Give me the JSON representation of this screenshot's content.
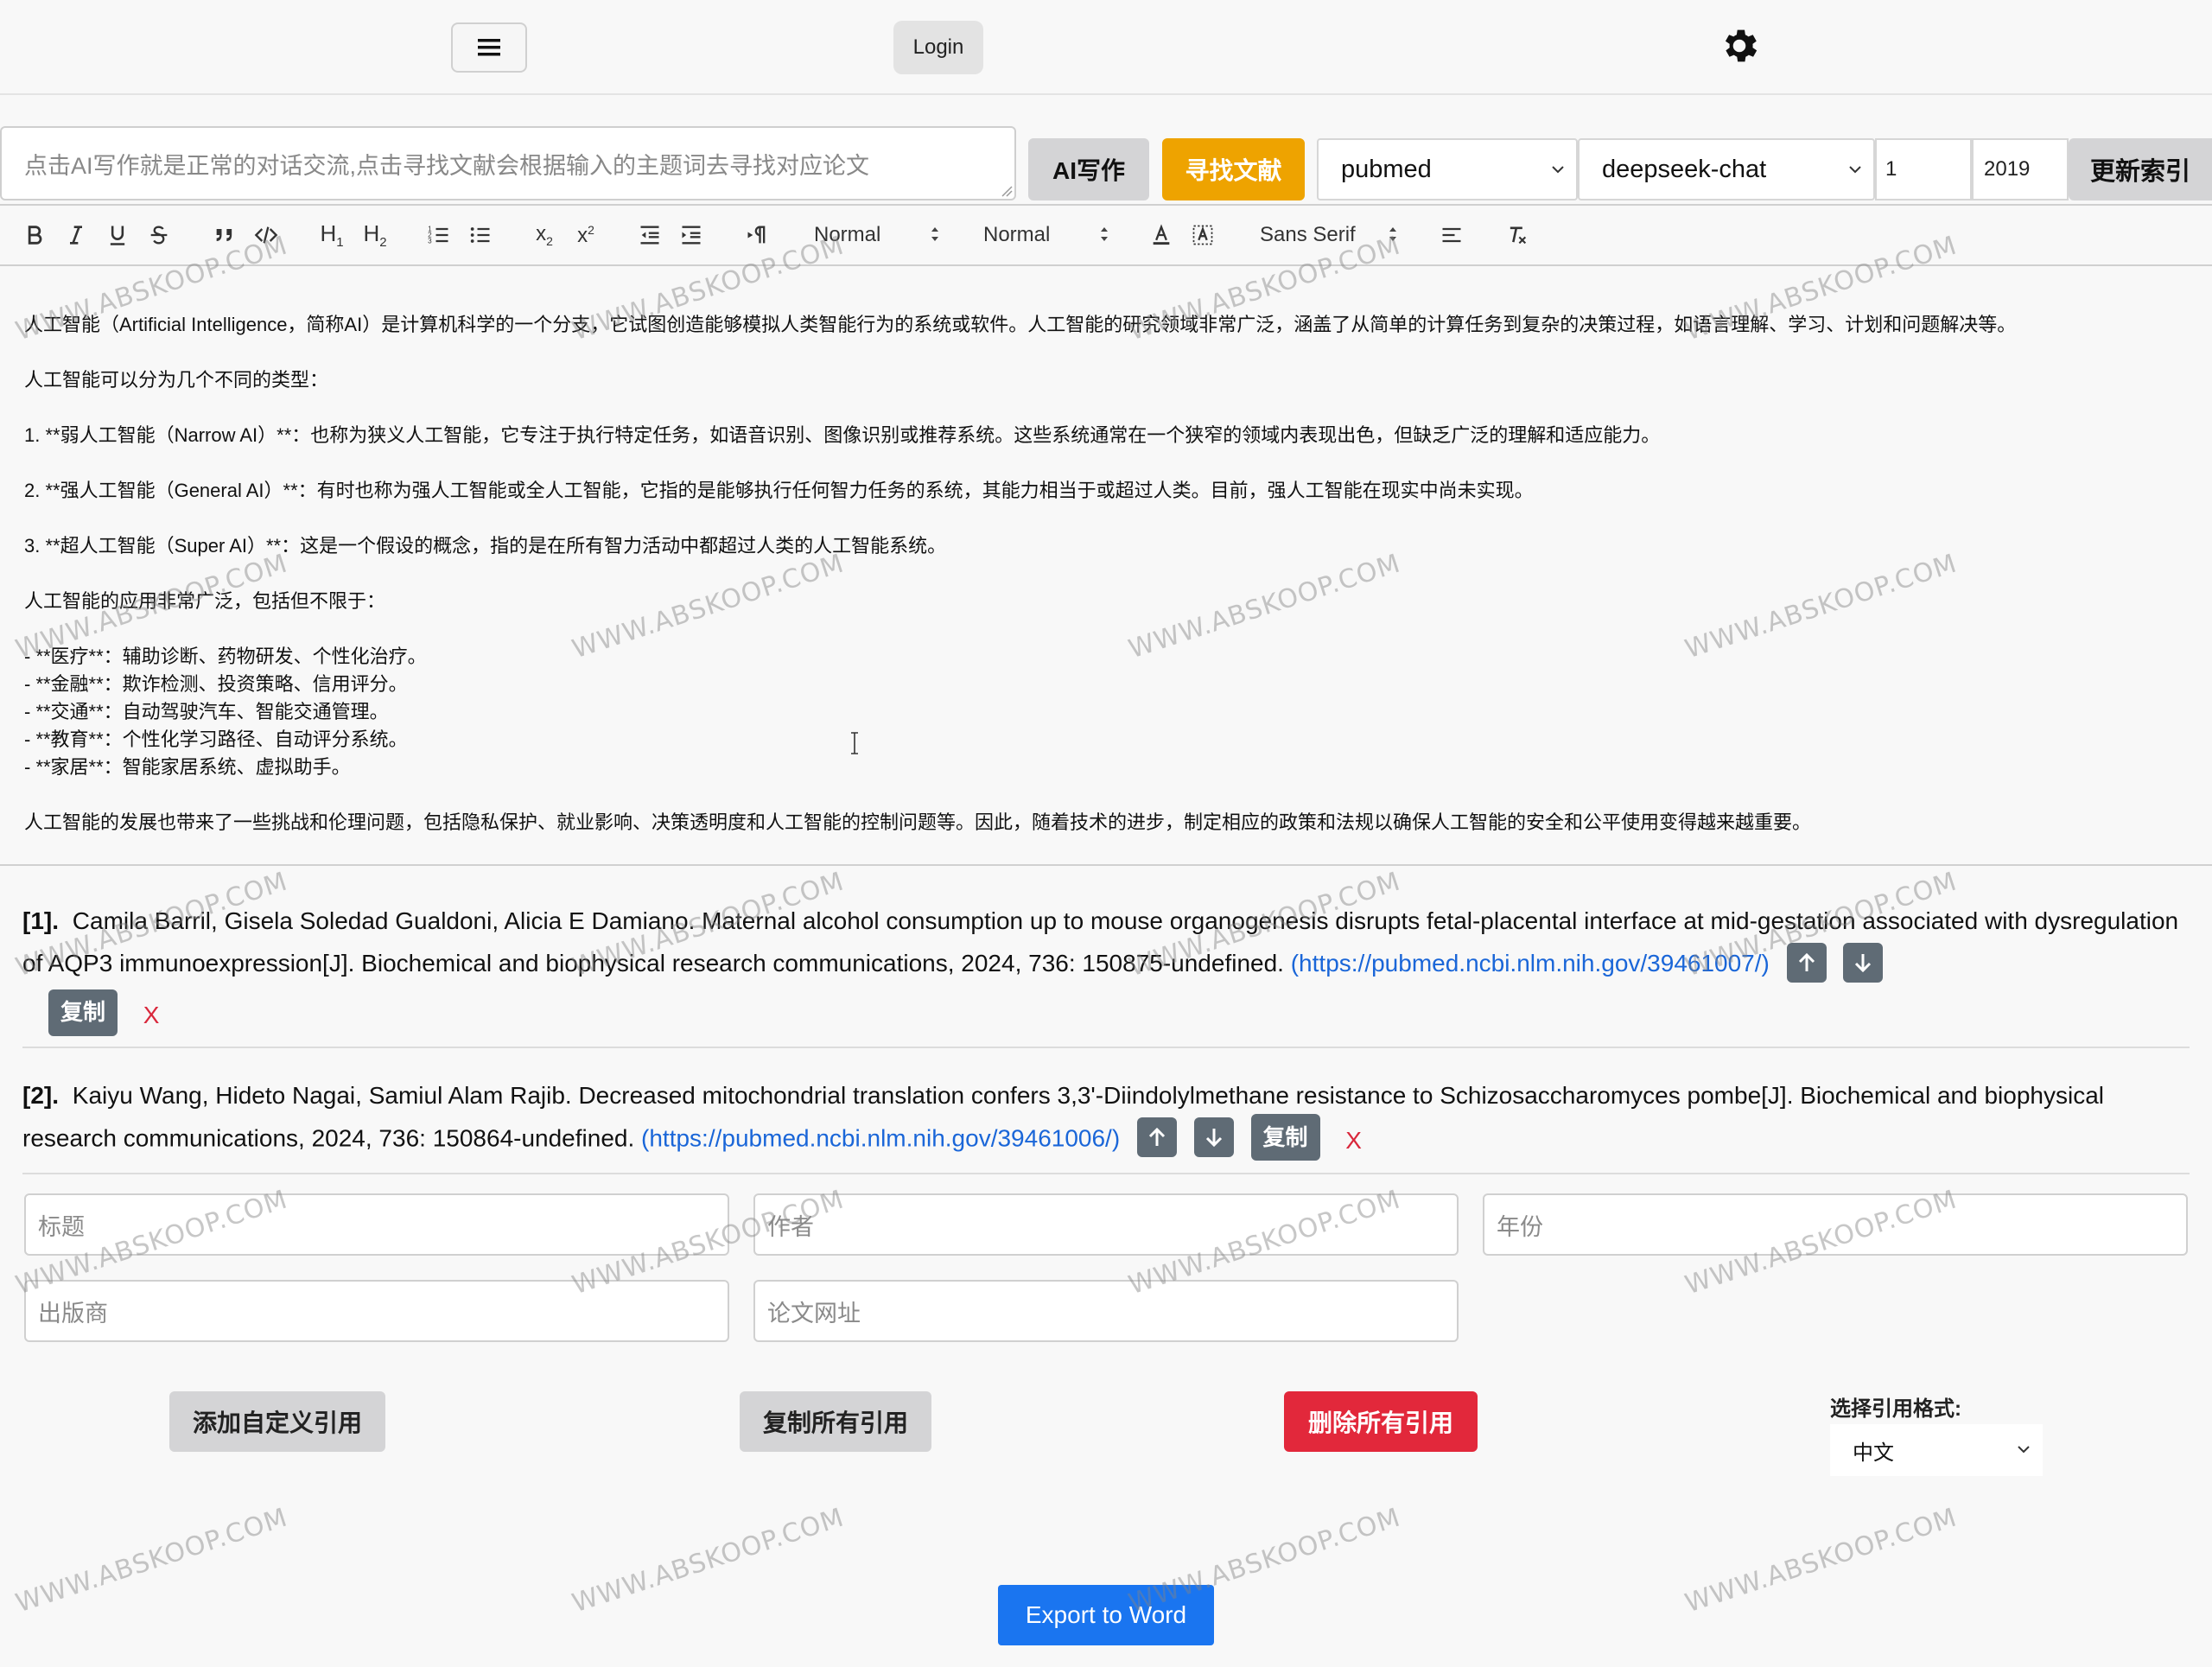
{
  "header": {
    "login_label": "Login"
  },
  "query": {
    "placeholder": "点击AI写作就是正常的对话交流,点击寻找文献会根据输入的主题词去寻找对应论文",
    "ai_write_label": "AI写作",
    "find_label": "寻找文献",
    "source_value": "pubmed",
    "model_value": "deepseek-chat",
    "count_value": "1",
    "year_value": "2019",
    "update_label": "更新索引"
  },
  "toolbar": {
    "header_pick": "Normal",
    "size_pick": "Normal",
    "font_pick": "Sans Serif"
  },
  "editor": {
    "lines": [
      "人工智能（Artificial Intelligence，简称AI）是计算机科学的一个分支，它试图创造能够模拟人类智能行为的系统或软件。人工智能的研究领域非常广泛，涵盖了从简单的计算任务到复杂的决策过程，如语言理解、学习、计划和问题解决等。",
      "人工智能可以分为几个不同的类型：",
      "1. **弱人工智能（Narrow AI）**：也称为狭义人工智能，它专注于执行特定任务，如语音识别、图像识别或推荐系统。这些系统通常在一个狭窄的领域内表现出色，但缺乏广泛的理解和适应能力。",
      "2. **强人工智能（General AI）**：有时也称为强人工智能或全人工智能，它指的是能够执行任何智力任务的系统，其能力相当于或超过人类。目前，强人工智能在现实中尚未实现。",
      "3. **超人工智能（Super AI）**：这是一个假设的概念，指的是在所有智力活动中都超过人类的人工智能系统。",
      "人工智能的应用非常广泛，包括但不限于：",
      "- **医疗**：辅助诊断、药物研发、个性化治疗。",
      "- **金融**：欺诈检测、投资策略、信用评分。",
      "- **交通**：自动驾驶汽车、智能交通管理。",
      "- **教育**：个性化学习路径、自动评分系统。",
      "- **家居**：智能家居系统、虚拟助手。",
      "人工智能的发展也带来了一些挑战和伦理问题，包括隐私保护、就业影响、决策透明度和人工智能的控制问题等。因此，随着技术的进步，制定相应的政策和法规以确保人工智能的安全和公平使用变得越来越重要。"
    ]
  },
  "references": [
    {
      "index": "[1].",
      "text": "Camila Barril, Gisela Soledad Gualdoni, Alicia E Damiano. Maternal alcohol consumption up to mouse organogenesis disrupts fetal-placental interface at mid-gestation associated with dysregulation of AQP3 immunoexpression[J]. Biochemical and biophysical research communications, 2024, 736: 150875-undefined.",
      "link": "(https://pubmed.ncbi.nlm.nih.gov/39461007/)",
      "copy_label": "复制",
      "delete_label": "X"
    },
    {
      "index": "[2].",
      "text": "Kaiyu Wang, Hideto Nagai, Samiul Alam Rajib. Decreased mitochondrial translation confers 3,3'-Diindolylmethane resistance to Schizosaccharomyces pombe[J]. Biochemical and biophysical research communications, 2024, 736: 150864-undefined.",
      "link": "(https://pubmed.ncbi.nlm.nih.gov/39461006/)",
      "copy_label": "复制",
      "delete_label": "X"
    }
  ],
  "custom_ref": {
    "title_placeholder": "标题",
    "author_placeholder": "作者",
    "year_placeholder": "年份",
    "publisher_placeholder": "出版商",
    "url_placeholder": "论文网址"
  },
  "actions": {
    "add_custom_label": "添加自定义引用",
    "copy_all_label": "复制所有引用",
    "delete_all_label": "删除所有引用",
    "format_label": "选择引用格式:",
    "format_value": "中文",
    "export_label": "Export to Word"
  },
  "watermark": "WWW.ABSKOOP.COM",
  "colors": {
    "accent_blue": "#1a75f0",
    "find_orange": "#eea300",
    "danger_red": "#e2283b",
    "icon_button": "#5f6b75",
    "link_blue": "#1a66d8"
  }
}
